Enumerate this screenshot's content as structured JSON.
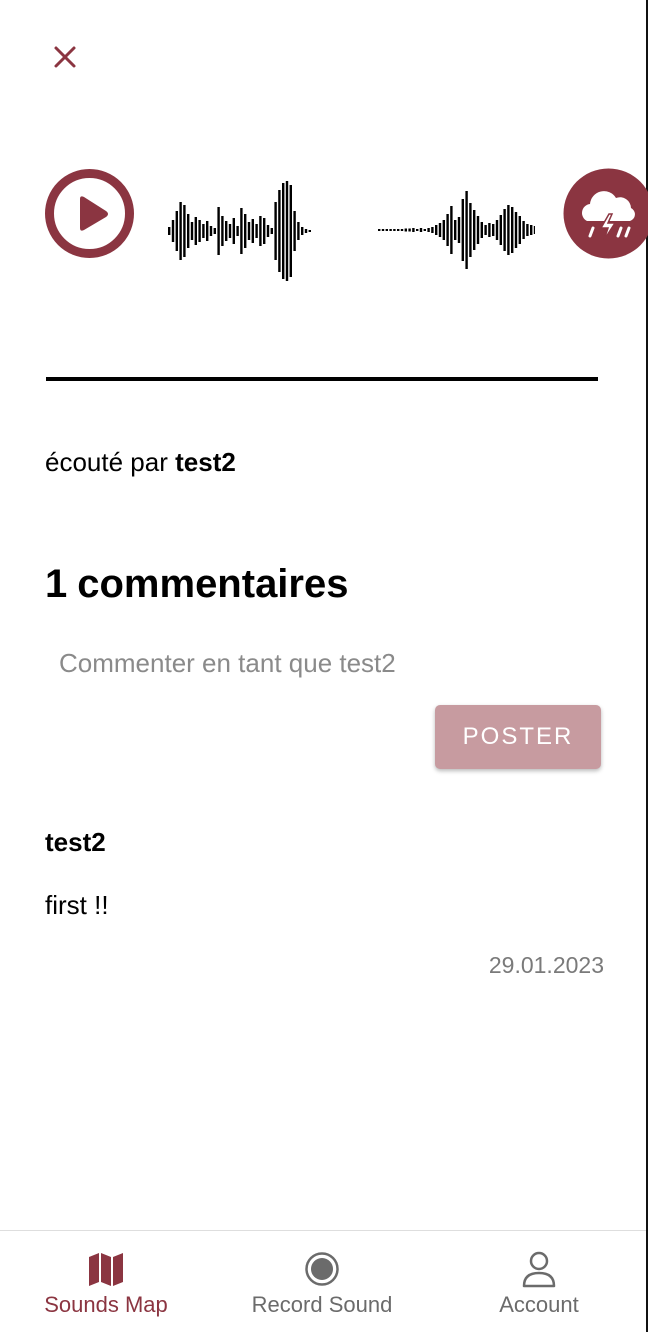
{
  "colors": {
    "accent": "#8b3541",
    "post_button": "#c79ba0",
    "muted_text": "#7a7a7a"
  },
  "header": {
    "close_icon": "close-icon"
  },
  "player": {
    "play_icon": "play-icon",
    "weather_icon": "storm-cloud-icon"
  },
  "listened": {
    "prefix": "écouté par",
    "user": "test2"
  },
  "comments": {
    "count": "1",
    "title": "commentaires",
    "input_placeholder": "Commenter en tant que test2",
    "post_label": "POSTER",
    "items": [
      {
        "author": "test2",
        "text": "first !!",
        "date": "29.01.2023"
      }
    ]
  },
  "nav": {
    "items": [
      {
        "label": "Sounds Map",
        "icon": "map-icon",
        "active": true
      },
      {
        "label": "Record Sound",
        "icon": "record-icon",
        "active": false
      },
      {
        "label": "Account",
        "icon": "account-icon",
        "active": false
      }
    ]
  }
}
